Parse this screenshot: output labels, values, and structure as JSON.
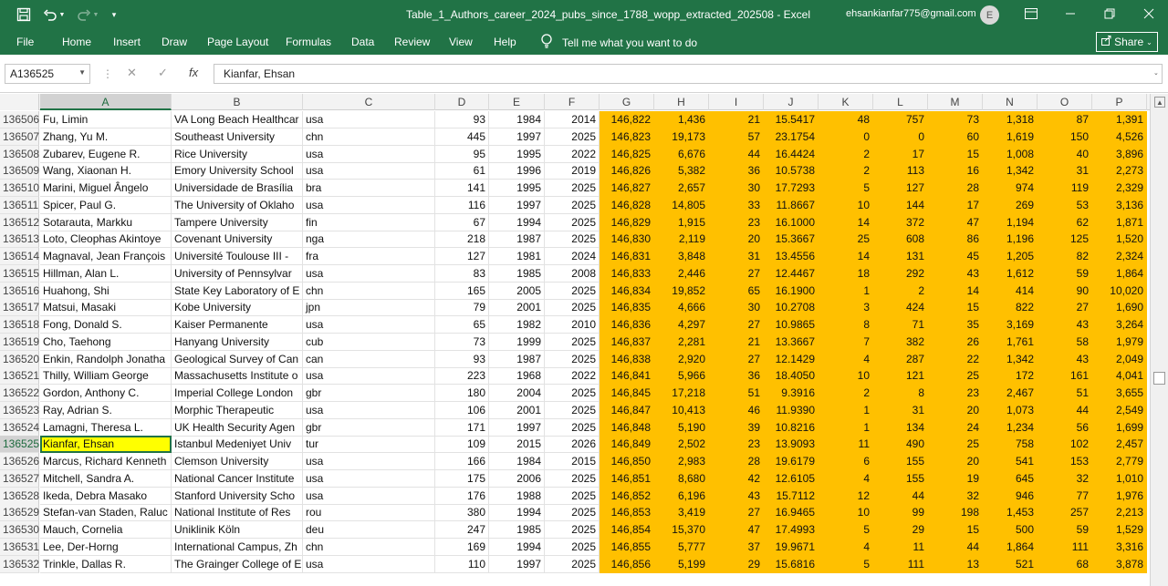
{
  "window": {
    "title": "Table_1_Authors_career_2024_pubs_since_1788_wopp_extracted_202508  -  Excel",
    "account": "ehsankianfar775@gmail.com",
    "avatar_initial": "E"
  },
  "ribbon": {
    "tabs": [
      "File",
      "Home",
      "Insert",
      "Draw",
      "Page Layout",
      "Formulas",
      "Data",
      "Review",
      "View",
      "Help"
    ],
    "tell_me": "Tell me what you want to do",
    "share_label": "Share"
  },
  "formula_bar": {
    "name_box": "A136525",
    "content": "Kianfar, Ehsan"
  },
  "columns": [
    "A",
    "B",
    "C",
    "D",
    "E",
    "F",
    "G",
    "H",
    "I",
    "J",
    "K",
    "L",
    "M",
    "N",
    "O",
    "P"
  ],
  "selected_column": "A",
  "selected_row": "136525",
  "highlight_color": "#FFC000",
  "active_cell_color": "#FFFF00",
  "rows": [
    {
      "n": "136506",
      "c": [
        "Fu, Limin",
        "VA Long Beach Healthcar",
        "usa",
        "93",
        "1984",
        "2014",
        "146,822",
        "1,436",
        "21",
        "15.5417",
        "48",
        "757",
        "73",
        "1,318",
        "87",
        "1,391"
      ]
    },
    {
      "n": "136507",
      "c": [
        "Zhang, Yu M.",
        "Southeast University",
        "chn",
        "445",
        "1997",
        "2025",
        "146,823",
        "19,173",
        "57",
        "23.1754",
        "0",
        "0",
        "60",
        "1,619",
        "150",
        "4,526"
      ]
    },
    {
      "n": "136508",
      "c": [
        "Zubarev, Eugene R.",
        "Rice University",
        "usa",
        "95",
        "1995",
        "2022",
        "146,825",
        "6,676",
        "44",
        "16.4424",
        "2",
        "17",
        "15",
        "1,008",
        "40",
        "3,896"
      ]
    },
    {
      "n": "136509",
      "c": [
        "Wang, Xiaonan H.",
        "Emory University School",
        "usa",
        "61",
        "1996",
        "2019",
        "146,826",
        "5,382",
        "36",
        "10.5738",
        "2",
        "113",
        "16",
        "1,342",
        "31",
        "2,273"
      ]
    },
    {
      "n": "136510",
      "c": [
        "Marini, Miguel Ângelo",
        "Universidade de Brasília",
        "bra",
        "141",
        "1995",
        "2025",
        "146,827",
        "2,657",
        "30",
        "17.7293",
        "5",
        "127",
        "28",
        "974",
        "119",
        "2,329"
      ]
    },
    {
      "n": "136511",
      "c": [
        "Spicer, Paul G.",
        "The University of Oklaho",
        "usa",
        "116",
        "1997",
        "2025",
        "146,828",
        "14,805",
        "33",
        "11.8667",
        "10",
        "144",
        "17",
        "269",
        "53",
        "3,136"
      ]
    },
    {
      "n": "136512",
      "c": [
        "Sotarauta, Markku",
        "Tampere University",
        "fin",
        "67",
        "1994",
        "2025",
        "146,829",
        "1,915",
        "23",
        "16.1000",
        "14",
        "372",
        "47",
        "1,194",
        "62",
        "1,871"
      ]
    },
    {
      "n": "136513",
      "c": [
        "Loto, Cleophas Akintoye",
        "Covenant University",
        "nga",
        "218",
        "1987",
        "2025",
        "146,830",
        "2,119",
        "20",
        "15.3667",
        "25",
        "608",
        "86",
        "1,196",
        "125",
        "1,520"
      ]
    },
    {
      "n": "136514",
      "c": [
        "Magnaval, Jean François",
        "Université Toulouse III -",
        "fra",
        "127",
        "1981",
        "2024",
        "146,831",
        "3,848",
        "31",
        "13.4556",
        "14",
        "131",
        "45",
        "1,205",
        "82",
        "2,324"
      ]
    },
    {
      "n": "136515",
      "c": [
        "Hillman, Alan L.",
        "University of Pennsylvar",
        "usa",
        "83",
        "1985",
        "2008",
        "146,833",
        "2,446",
        "27",
        "12.4467",
        "18",
        "292",
        "43",
        "1,612",
        "59",
        "1,864"
      ]
    },
    {
      "n": "136516",
      "c": [
        "Huahong, Shi",
        "State Key Laboratory of E",
        "chn",
        "165",
        "2005",
        "2025",
        "146,834",
        "19,852",
        "65",
        "16.1900",
        "1",
        "2",
        "14",
        "414",
        "90",
        "10,020"
      ]
    },
    {
      "n": "136517",
      "c": [
        "Matsui, Masaki",
        "Kobe University",
        "jpn",
        "79",
        "2001",
        "2025",
        "146,835",
        "4,666",
        "30",
        "10.2708",
        "3",
        "424",
        "15",
        "822",
        "27",
        "1,690"
      ]
    },
    {
      "n": "136518",
      "c": [
        "Fong, Donald S.",
        "Kaiser Permanente",
        "usa",
        "65",
        "1982",
        "2010",
        "146,836",
        "4,297",
        "27",
        "10.9865",
        "8",
        "71",
        "35",
        "3,169",
        "43",
        "3,264"
      ]
    },
    {
      "n": "136519",
      "c": [
        "Cho, Taehong",
        "Hanyang University",
        "cub",
        "73",
        "1999",
        "2025",
        "146,837",
        "2,281",
        "21",
        "13.3667",
        "7",
        "382",
        "26",
        "1,761",
        "58",
        "1,979"
      ]
    },
    {
      "n": "136520",
      "c": [
        "Enkin, Randolph Jonatha",
        "Geological Survey of Can",
        "can",
        "93",
        "1987",
        "2025",
        "146,838",
        "2,920",
        "27",
        "12.1429",
        "4",
        "287",
        "22",
        "1,342",
        "43",
        "2,049"
      ]
    },
    {
      "n": "136521",
      "c": [
        "Thilly, William George",
        "Massachusetts Institute o",
        "usa",
        "223",
        "1968",
        "2022",
        "146,841",
        "5,966",
        "36",
        "18.4050",
        "10",
        "121",
        "25",
        "172",
        "161",
        "4,041"
      ]
    },
    {
      "n": "136522",
      "c": [
        "Gordon, Anthony C.",
        "Imperial College London",
        "gbr",
        "180",
        "2004",
        "2025",
        "146,845",
        "17,218",
        "51",
        "9.3916",
        "2",
        "8",
        "23",
        "2,467",
        "51",
        "3,655"
      ]
    },
    {
      "n": "136523",
      "c": [
        "Ray, Adrian S.",
        "Morphic Therapeutic",
        "usa",
        "106",
        "2001",
        "2025",
        "146,847",
        "10,413",
        "46",
        "11.9390",
        "1",
        "31",
        "20",
        "1,073",
        "44",
        "2,549"
      ]
    },
    {
      "n": "136524",
      "c": [
        "Lamagni, Theresa L.",
        "UK Health Security Agen",
        "gbr",
        "171",
        "1997",
        "2025",
        "146,848",
        "5,190",
        "39",
        "10.8216",
        "1",
        "134",
        "24",
        "1,234",
        "56",
        "1,699"
      ]
    },
    {
      "n": "136525",
      "c": [
        "Kianfar, Ehsan",
        "Istanbul Medeniyet Univ",
        "tur",
        "109",
        "2015",
        "2026",
        "146,849",
        "2,502",
        "23",
        "13.9093",
        "11",
        "490",
        "25",
        "758",
        "102",
        "2,457"
      ]
    },
    {
      "n": "136526",
      "c": [
        "Marcus, Richard Kenneth",
        "Clemson University",
        "usa",
        "166",
        "1984",
        "2015",
        "146,850",
        "2,983",
        "28",
        "19.6179",
        "6",
        "155",
        "20",
        "541",
        "153",
        "2,779"
      ]
    },
    {
      "n": "136527",
      "c": [
        "Mitchell, Sandra A.",
        "National Cancer Institute",
        "usa",
        "175",
        "2006",
        "2025",
        "146,851",
        "8,680",
        "42",
        "12.6105",
        "4",
        "155",
        "19",
        "645",
        "32",
        "1,010"
      ]
    },
    {
      "n": "136528",
      "c": [
        "Ikeda, Debra Masako",
        "Stanford University Scho",
        "usa",
        "176",
        "1988",
        "2025",
        "146,852",
        "6,196",
        "43",
        "15.7112",
        "12",
        "44",
        "32",
        "946",
        "77",
        "1,976"
      ]
    },
    {
      "n": "136529",
      "c": [
        "Stefan-van Staden, Raluc",
        "National Institute of Res",
        "rou",
        "380",
        "1994",
        "2025",
        "146,853",
        "3,419",
        "27",
        "16.9465",
        "10",
        "99",
        "198",
        "1,453",
        "257",
        "2,213"
      ]
    },
    {
      "n": "136530",
      "c": [
        "Mauch, Cornelia",
        "Uniklinik Köln",
        "deu",
        "247",
        "1985",
        "2025",
        "146,854",
        "15,370",
        "47",
        "17.4993",
        "5",
        "29",
        "15",
        "500",
        "59",
        "1,529"
      ]
    },
    {
      "n": "136531",
      "c": [
        "Lee, Der-Horng",
        "International Campus, Zh",
        "chn",
        "169",
        "1994",
        "2025",
        "146,855",
        "5,777",
        "37",
        "19.9671",
        "4",
        "11",
        "44",
        "1,864",
        "111",
        "3,316"
      ]
    },
    {
      "n": "136532",
      "c": [
        "Trinkle, Dallas R.",
        "The Grainger College of E",
        "usa",
        "110",
        "1997",
        "2025",
        "146,856",
        "5,199",
        "29",
        "15.6816",
        "5",
        "111",
        "13",
        "521",
        "68",
        "3,878"
      ]
    }
  ]
}
